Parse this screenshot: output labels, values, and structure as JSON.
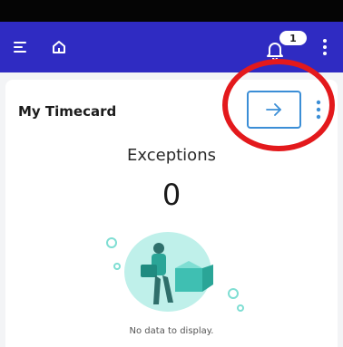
{
  "header": {
    "notification_count": "1"
  },
  "card": {
    "title": "My Timecard",
    "exceptions_label": "Exceptions",
    "exceptions_count": "0",
    "empty_message": "No data to display."
  },
  "colors": {
    "app_bar": "#2f2bc2",
    "accent_border": "#3b8ed6",
    "highlight": "#e3191c",
    "illustration_teal": "#4fd1c5"
  },
  "icons": {
    "menu": "hamburger-menu-icon",
    "home": "home-icon",
    "notifications": "bell-icon",
    "overflow": "more-vertical-icon",
    "go": "arrow-right-icon"
  }
}
